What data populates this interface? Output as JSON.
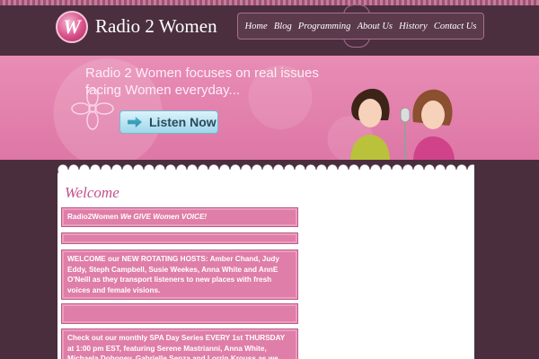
{
  "site": {
    "title": "Radio 2 Women",
    "logo_letter": "W"
  },
  "nav": {
    "items": [
      {
        "label": "Home"
      },
      {
        "label": "Blog"
      },
      {
        "label": "Programming"
      },
      {
        "label": "About Us"
      },
      {
        "label": "History"
      },
      {
        "label": "Contact Us"
      }
    ]
  },
  "banner": {
    "tagline": "Radio 2 Women focuses on real issues facing Women everyday...",
    "listen_label": "Listen Now"
  },
  "content": {
    "heading": "Welcome",
    "box1_strong": "Radio2Women",
    "box1_em": " We GIVE Women VOICE!",
    "box3": "WELCOME our NEW ROTATING HOSTS: Amber Chand, Judy Eddy, Steph Campbell, Susie Weekes, Anna White and AnnE O'Neill as they transport listeners to new places with fresh voices and female visions.",
    "box5": "Check out our monthly SPA Day Series EVERY 1st THURSDAY at 1:00 pm EST, featuring Serene Mastrianni, Anna White, Michaela Dohoney, Gabrielle Senza and Lorrin Krouss as we CHEW on a"
  },
  "colors": {
    "header_bg": "#4b2f3f",
    "banner_pink": "#e07aa9",
    "accent_pink": "#c4508a",
    "listen_blue": "#9fd7ea"
  }
}
